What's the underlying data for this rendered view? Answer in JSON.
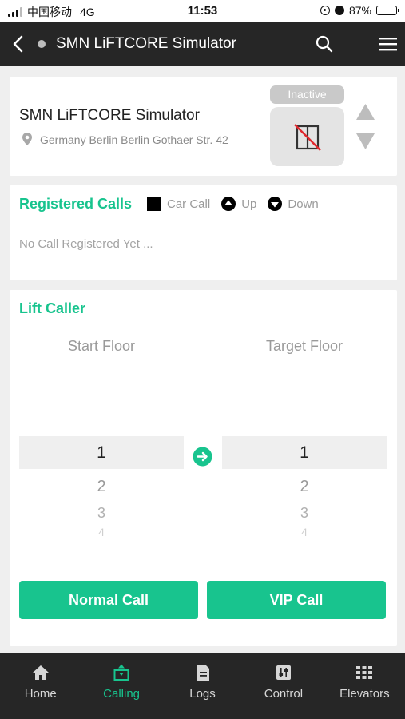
{
  "status_bar": {
    "carrier": "中国移动",
    "network": "4G",
    "time": "11:53",
    "battery": "87%",
    "battery_level": 0.87
  },
  "header": {
    "title": "SMN LiFTCORE Simulator"
  },
  "site": {
    "name": "SMN LiFTCORE Simulator",
    "address": "Germany Berlin Berlin Gothaer Str. 42",
    "status": "Inactive"
  },
  "registered_calls": {
    "title": "Registered Calls",
    "legend": {
      "car_call": "Car Call",
      "up": "Up",
      "down": "Down"
    },
    "empty_text": "No Call Registered Yet ..."
  },
  "lift_caller": {
    "title": "Lift Caller",
    "start_label": "Start Floor",
    "target_label": "Target Floor",
    "start_floors": [
      "1",
      "2",
      "3",
      "4"
    ],
    "target_floors": [
      "1",
      "2",
      "3",
      "4"
    ],
    "normal_call": "Normal Call",
    "vip_call": "VIP Call"
  },
  "nav": {
    "items": [
      {
        "label": "Home",
        "icon": "home-icon"
      },
      {
        "label": "Calling",
        "icon": "calling-icon"
      },
      {
        "label": "Logs",
        "icon": "logs-icon"
      },
      {
        "label": "Control",
        "icon": "control-icon"
      },
      {
        "label": "Elevators",
        "icon": "elevators-icon"
      }
    ],
    "active": "Calling"
  },
  "colors": {
    "accent": "#18c48e",
    "header_bg": "#262626",
    "page_bg": "#efefef",
    "inactive_tag": "#c9c9c9",
    "alert_red": "#e0282e"
  }
}
